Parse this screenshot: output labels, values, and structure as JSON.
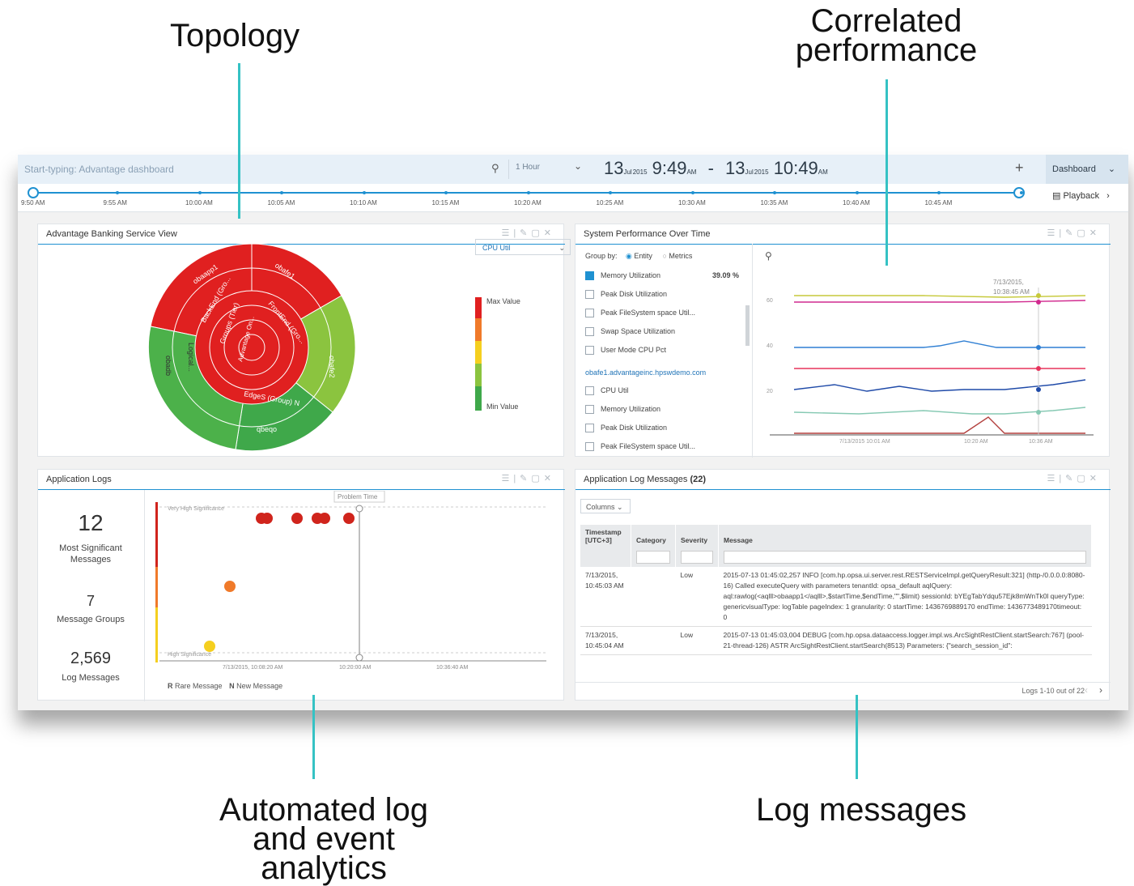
{
  "callouts": {
    "topology": "Topology",
    "correlated": "Correlated performance",
    "analytics": "Automated log and event analytics",
    "logmessages": "Log messages"
  },
  "topbar": {
    "search_placeholder": "Start-typing: Advantage dashboard",
    "range": "1 Hour",
    "from_day": "13",
    "from_month": "Jul",
    "from_year": "2015",
    "from_time": "9:49",
    "from_ampm": "AM",
    "dash": "-",
    "to_day": "13",
    "to_month": "Jul",
    "to_year": "2015",
    "to_time": "10:49",
    "to_ampm": "AM",
    "dashboard_label": "Dashboard",
    "playback_label": "Playback"
  },
  "timeline": {
    "ticks": [
      "9:50 AM",
      "9:55 AM",
      "10:00 AM",
      "10:05 AM",
      "10:10 AM",
      "10:15 AM",
      "10:20 AM",
      "10:25 AM",
      "10:30 AM",
      "10:35 AM",
      "10:40 AM",
      "10:45 AM"
    ]
  },
  "topology_panel": {
    "title": "Advantage Banking Service View",
    "metric": "CPU Util",
    "max_label": "Max Value",
    "min_label": "Min Value",
    "segments": [
      "obaapp1",
      "obafe1",
      "BackEnd (Gro...",
      "FrontEnd (Gro...",
      "Groups (Tier)",
      "Advantage On...",
      "obafe2",
      "obadb",
      "Logical...",
      "obaqb",
      "EdgeS (Group) N",
      "qbeqo"
    ]
  },
  "perf_panel": {
    "title": "System Performance Over Time",
    "group_by": "Group by:",
    "opt_entity": "Entity",
    "opt_metrics": "Metrics",
    "metrics": [
      {
        "label": "Memory Utilization",
        "checked": true,
        "value": "39.09 %"
      },
      {
        "label": "Peak Disk Utilization",
        "checked": false
      },
      {
        "label": "Peak FileSystem space Util...",
        "checked": false
      },
      {
        "label": "Swap Space Utilization",
        "checked": false
      },
      {
        "label": "User Mode CPU Pct",
        "checked": false
      }
    ],
    "host": "obafe1.advantageinc.hpswdemo.com",
    "host_metrics": [
      "CPU Util",
      "Memory Utilization",
      "Peak Disk Utilization",
      "Peak FileSystem space Util..."
    ],
    "tooltip_date": "7/13/2015,",
    "tooltip_time": "10:38:45 AM",
    "y_ticks": [
      "60",
      "40",
      "20"
    ],
    "x_ticks": [
      "7/13/2015 10:01 AM",
      "10:20 AM",
      "10:36 AM"
    ],
    "series_colors": [
      "#c6c93a",
      "#d12a8f",
      "#2f7fd3",
      "#e7335c",
      "#1f4aa8",
      "#86c9b3",
      "#b3413f"
    ]
  },
  "applogs_panel": {
    "title": "Application Logs",
    "most_count": "12",
    "most_label": "Most Significant Messages",
    "groups_count": "7",
    "groups_label": "Message Groups",
    "log_count": "2,569",
    "log_label": "Log Messages",
    "problem_time": "Problem Time",
    "very_high": "Very High Significance",
    "high": "High Significance",
    "x_ticks": [
      "7/13/2015, 10:08:20 AM",
      "10:20:00 AM",
      "10:36:40 AM"
    ],
    "legend_r": "R",
    "legend_rare": "Rare Message",
    "legend_n": "N",
    "legend_new": "New Message"
  },
  "logmsg_panel": {
    "title": "Application Log Messages",
    "count": "(22)",
    "columns_btn": "Columns",
    "headers": {
      "timestamp": "Timestamp [UTC+3]",
      "category": "Category",
      "severity": "Severity",
      "message": "Message"
    },
    "rows": [
      {
        "ts": "7/13/2015, 10:45:03 AM",
        "category": "",
        "severity": "Low",
        "message": "2015-07-13 01:45:02,257 INFO [com.hp.opsa.ui.server.rest.RESTServiceImpl.getQueryResult:321] (http-/0.0.0.0:8080-16) Called executeQuery with parameters tenantId: opsa_default aqlQuery: aql:rawlog(<aqlll>obaapp1</aqlll>,$startTime,$endTime,\"\",$limit) sessionId: bYEgTabYdqu57Ejk8mWnTk0l queryType: genericvisualType: logTable pageIndex: 1 granularity: 0 startTime: 1436769889170 endTime: 1436773489170timeout: 0"
      },
      {
        "ts": "7/13/2015, 10:45:04 AM",
        "category": "",
        "severity": "Low",
        "message": "2015-07-13 01:45:03,004 DEBUG [com.hp.opsa.dataaccess.logger.impl.ws.ArcSightRestClient.startSearch:767] (pool-21-thread-126) ASTR ArcSightRestClient.startSearch(8513) Parameters: {\"search_session_id\":"
      }
    ],
    "pager": "Logs 1-10 out of 22"
  }
}
